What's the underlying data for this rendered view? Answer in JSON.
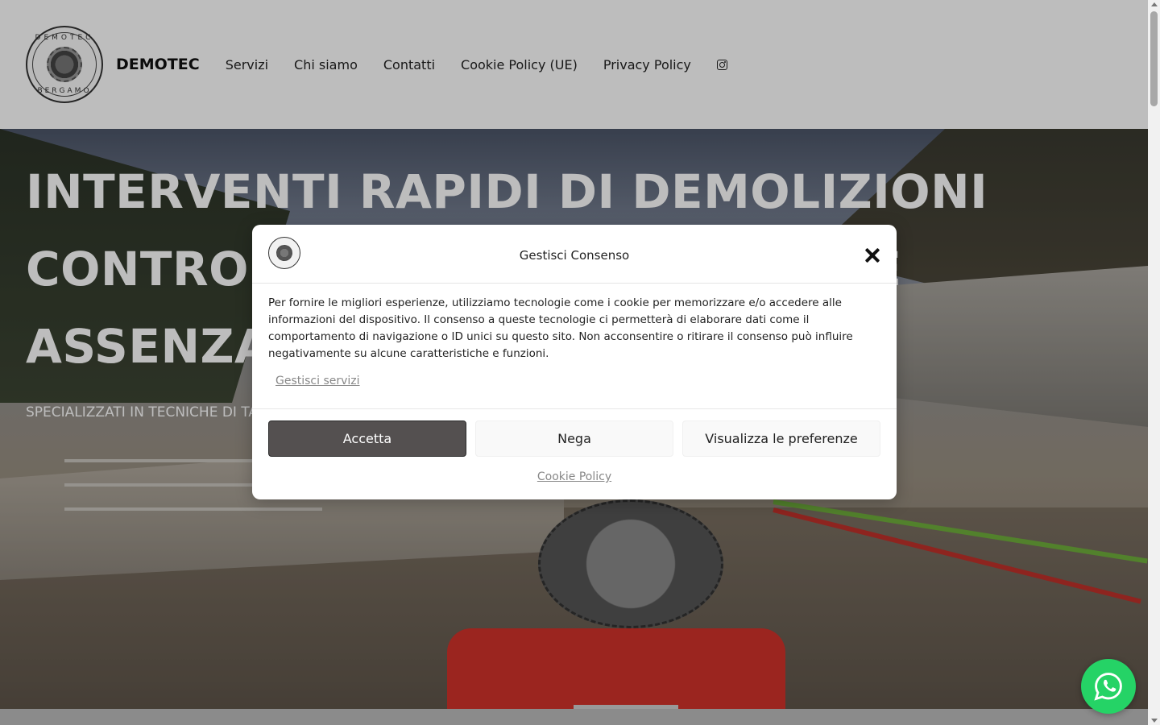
{
  "header": {
    "logo_top": "DEMOTEC",
    "logo_bottom": "BERGAMO",
    "brand": "DEMOTEC",
    "nav": [
      {
        "label": "Servizi"
      },
      {
        "label": "Chi siamo"
      },
      {
        "label": "Contatti"
      },
      {
        "label": "Cookie Policy (UE)"
      },
      {
        "label": "Privacy Policy"
      }
    ],
    "social_icon": "instagram-icon"
  },
  "hero": {
    "title": "INTERVENTI RAPIDI DI DEMOLIZIONI CONTROLLATE SENZA POLVERE E ASSENZA DI VIBRAZIONI",
    "subtitle": "SPECIALIZZATI IN TECNICHE DI TAGLIO"
  },
  "cookie_modal": {
    "title": "Gestisci Consenso",
    "body": "Per fornire le migliori esperienze, utilizziamo tecnologie come i cookie per memorizzare e/o accedere alle informazioni del dispositivo. Il consenso a queste tecnologie ci permetterà di elaborare dati come il comportamento di navigazione o ID unici su questo sito. Non acconsentire o ritirare il consenso può influire negativamente su alcune caratteristiche e funzioni.",
    "manage_services": "Gestisci servizi",
    "accept": "Accetta",
    "deny": "Nega",
    "preferences": "Visualizza le preferenze",
    "cookie_policy": "Cookie Policy",
    "close_icon": "close-icon"
  },
  "floating": {
    "whatsapp_icon": "whatsapp-icon",
    "color": "#25d366"
  },
  "colors": {
    "accept_button": "#545050",
    "header_bg": "#ffffff"
  }
}
